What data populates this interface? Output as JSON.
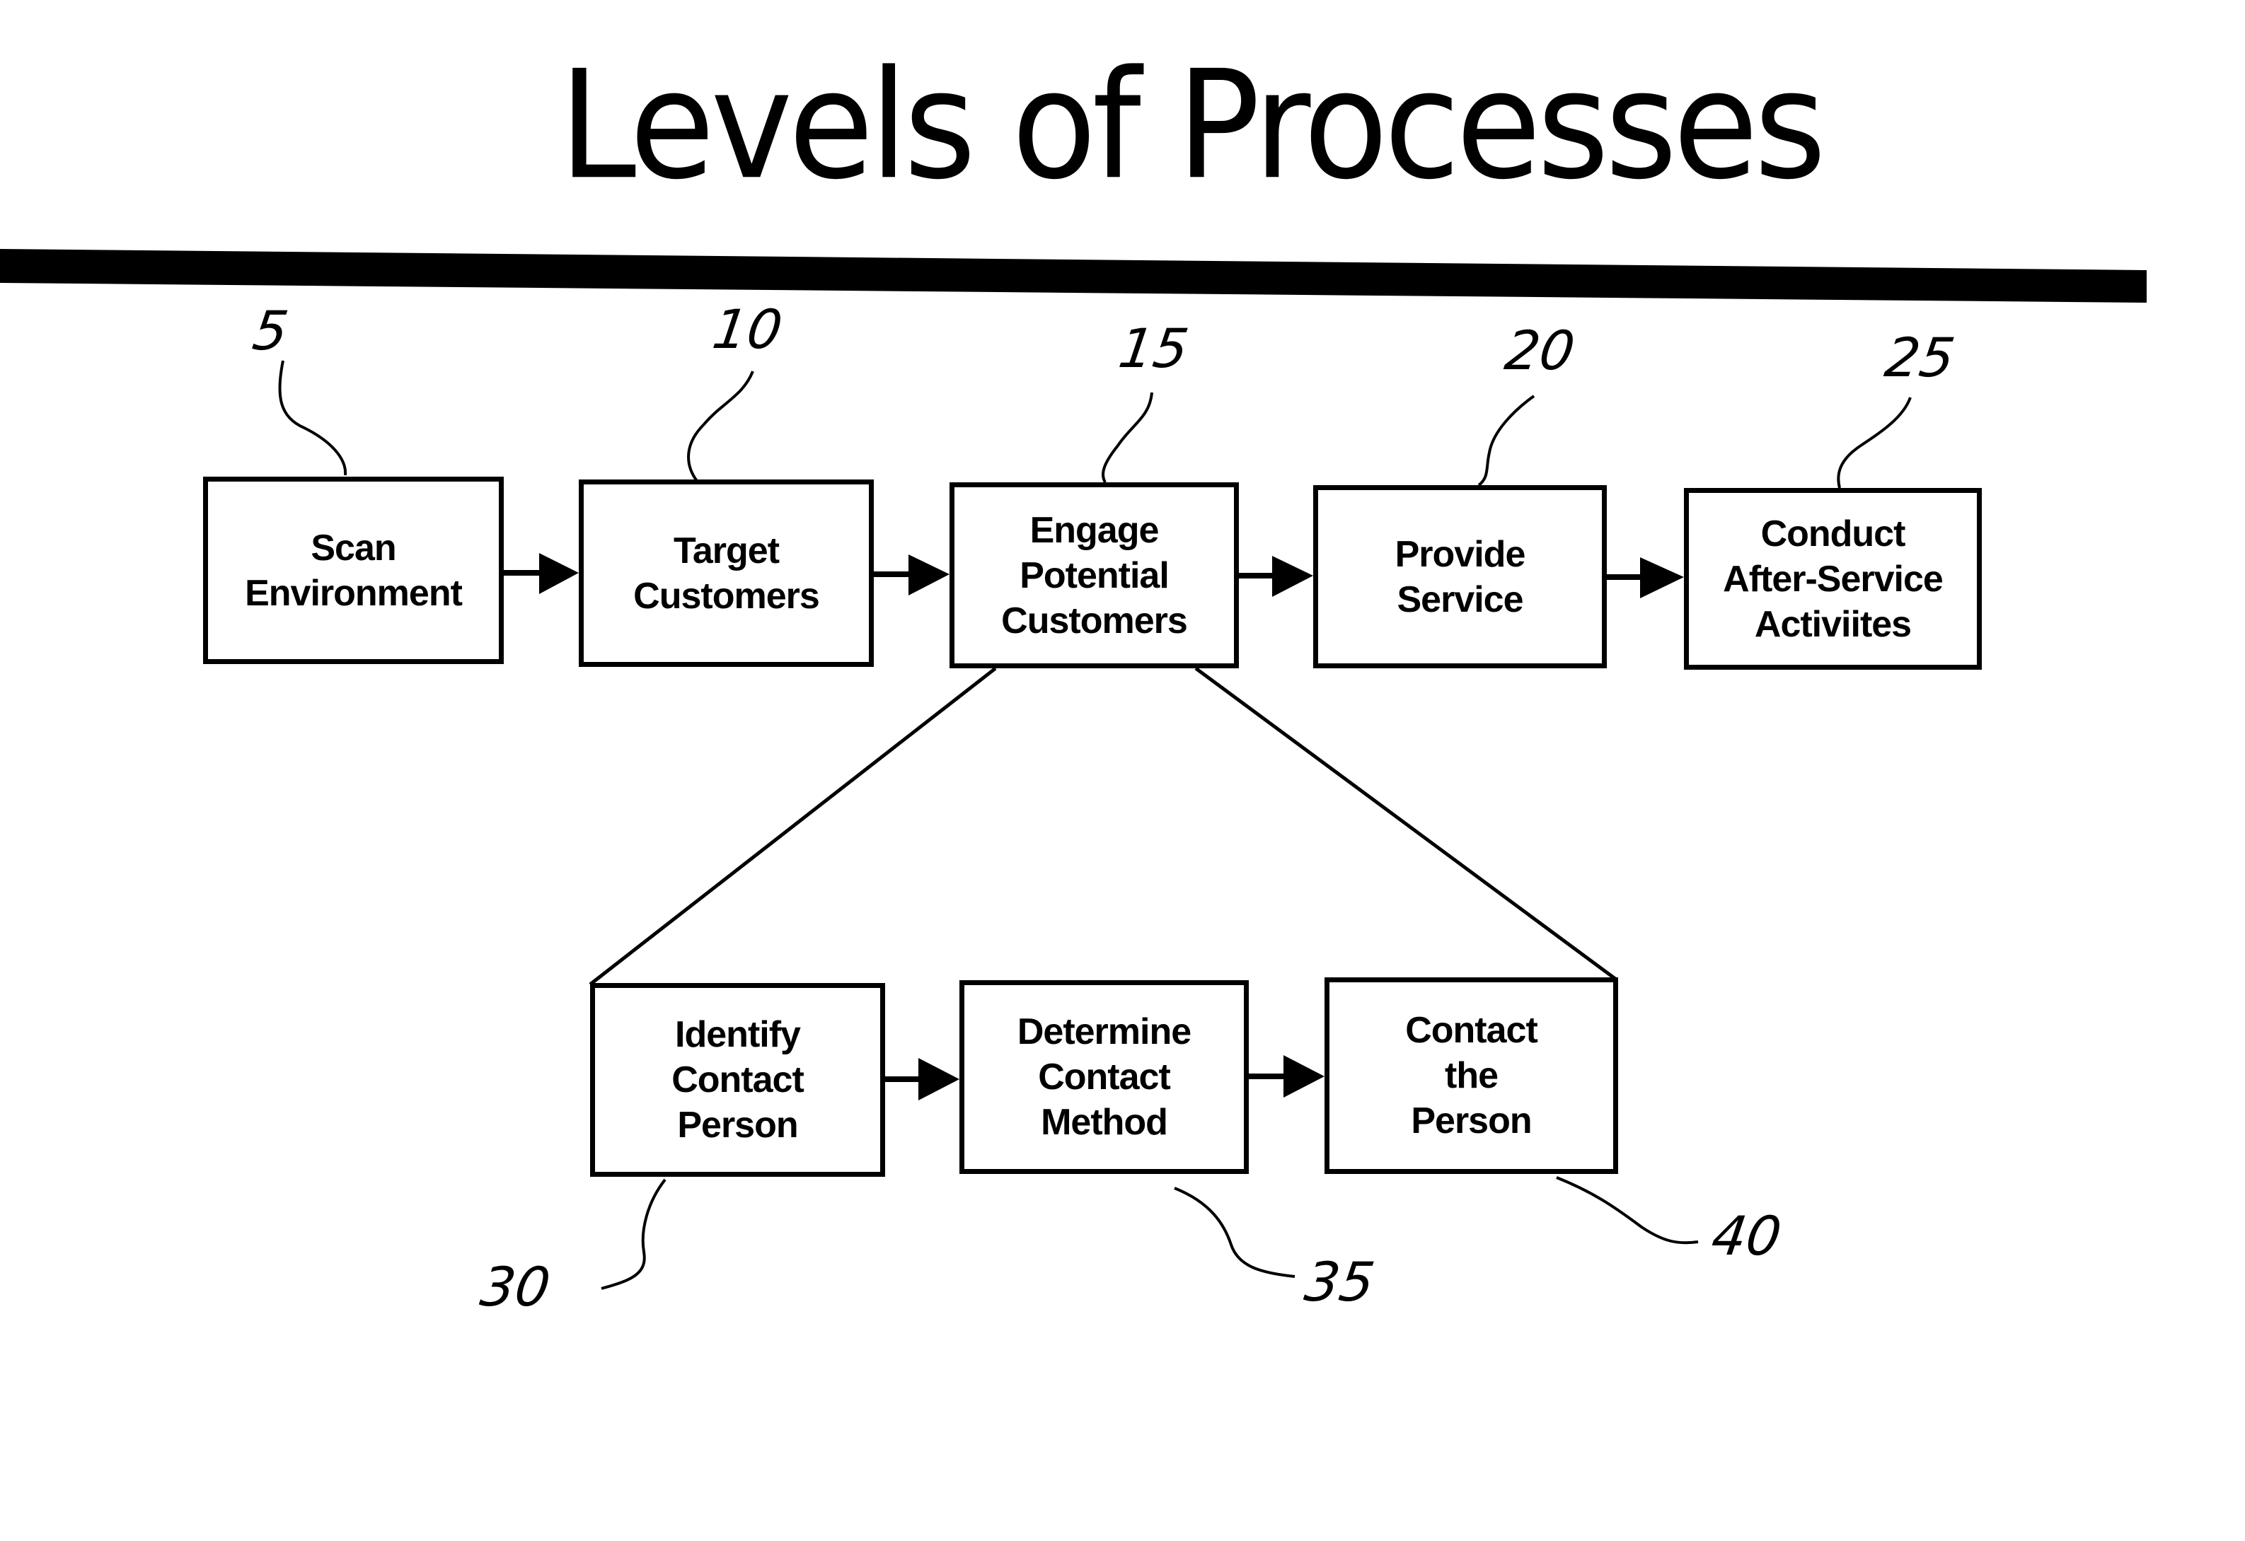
{
  "title": "Levels of Processes",
  "top_level": {
    "steps": [
      {
        "ref": "5",
        "label": "Scan\nEnvironment"
      },
      {
        "ref": "10",
        "label": "Target\nCustomers"
      },
      {
        "ref": "15",
        "label": "Engage\nPotential\nCustomers"
      },
      {
        "ref": "20",
        "label": "Provide\nService"
      },
      {
        "ref": "25",
        "label": "Conduct\nAfter-Service\nActiviites"
      }
    ]
  },
  "sub_level": {
    "parent_ref": "15",
    "steps": [
      {
        "ref": "30",
        "label": "Identify\nContact\nPerson"
      },
      {
        "ref": "35",
        "label": "Determine\nContact\nMethod"
      },
      {
        "ref": "40",
        "label": "Contact\nthe\nPerson"
      }
    ]
  },
  "colors": {
    "ink": "#000000",
    "paper": "#ffffff"
  }
}
